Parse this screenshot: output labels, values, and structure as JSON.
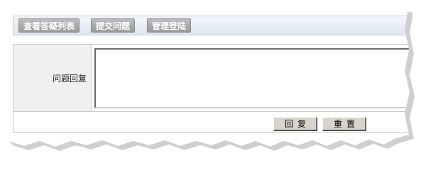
{
  "toolbar": {
    "items": [
      {
        "label": "查看答疑列表"
      },
      {
        "label": "提交问题"
      },
      {
        "label": "管理登陆"
      }
    ]
  },
  "form": {
    "reply_label": "问题回复",
    "reply_value": ""
  },
  "buttons": {
    "submit_label": "回复",
    "reset_label": "重置"
  },
  "colors": {
    "toolbar_button": "#a8a8a8",
    "toolbar_bg": "#e6ecf5",
    "label_cell_bg": "#f0f0f0",
    "form_button_bg": "#d8d4cc"
  }
}
